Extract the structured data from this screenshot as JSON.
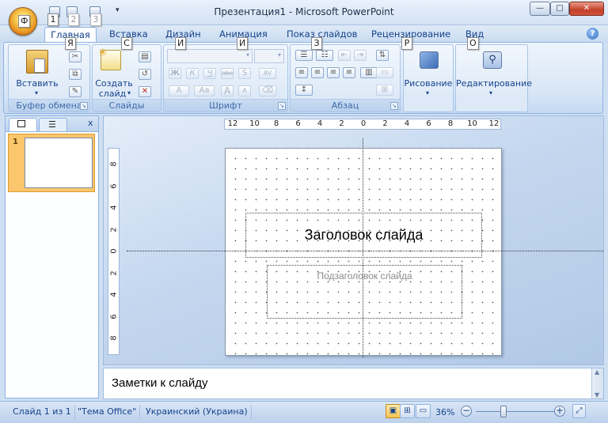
{
  "window": {
    "title": "Презентация1 - Microsoft PowerPoint",
    "office_button_keytip": "Ф",
    "qat_keytips": [
      "1",
      "2",
      "3"
    ],
    "min_label": "—",
    "max_label": "□",
    "close_label": "✕"
  },
  "tabs": [
    {
      "label": "Главная",
      "keytip": "Я"
    },
    {
      "label": "Вставка",
      "keytip": "С"
    },
    {
      "label": "Дизайн",
      "keytip": "И"
    },
    {
      "label": "Анимация",
      "keytip": "И"
    },
    {
      "label": "Показ слайдов",
      "keytip": "З"
    },
    {
      "label": "Рецензирование",
      "keytip": "Р"
    },
    {
      "label": "Вид",
      "keytip": "О"
    }
  ],
  "help_label": "?",
  "ribbon": {
    "clipboard": {
      "label": "Буфер обмена",
      "paste": "Вставить"
    },
    "slides": {
      "label": "Слайды",
      "new_slide_line1": "Создать",
      "new_slide_line2": "слайд"
    },
    "font": {
      "label": "Шрифт",
      "bold": "Ж",
      "italic": "К",
      "underline": "Ч",
      "strike": "abc",
      "shadow": "S",
      "spacing": "AV",
      "font_color": "A",
      "case": "Aa",
      "grow": "A",
      "shrink": "A"
    },
    "paragraph": {
      "label": "Абзац"
    },
    "drawing": {
      "label": "Рисование"
    },
    "editing": {
      "label": "Редактирование"
    }
  },
  "slide_pane": {
    "close_label": "x",
    "thumbnail_number": "1"
  },
  "ruler": {
    "horizontal": [
      "12",
      "10",
      "8",
      "6",
      "4",
      "2",
      "0",
      "2",
      "4",
      "6",
      "8",
      "10",
      "12"
    ],
    "vertical": [
      "8",
      "6",
      "4",
      "2",
      "0",
      "2",
      "4",
      "6",
      "8"
    ]
  },
  "slide": {
    "title_placeholder": "Заголовок слайда",
    "subtitle_placeholder": "Подзаголовок слайда"
  },
  "notes": {
    "placeholder": "Заметки к слайду"
  },
  "status": {
    "slide_info": "Слайд 1 из 1",
    "theme": "\"Тема Office\"",
    "language": "Украинский (Украина)",
    "zoom": "36%",
    "zoom_level_percent": 36
  },
  "colors": {
    "accent": "#15428b",
    "ribbon_bg": "#dbe7f7",
    "selected_thumb": "#fbc66c"
  }
}
